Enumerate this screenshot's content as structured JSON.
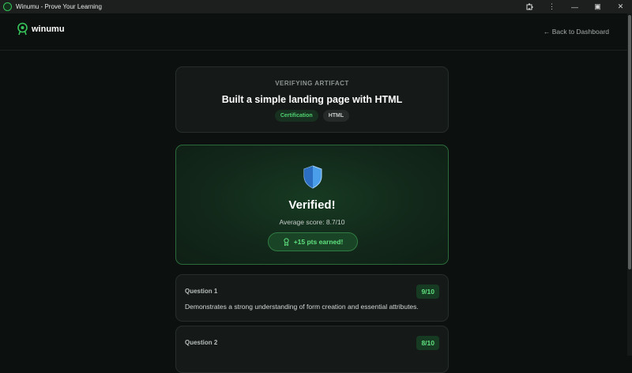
{
  "window": {
    "title": "Winumu - Prove Your Learning",
    "controls": {
      "extensions": "extensions-icon",
      "menu": "⋮",
      "minimize": "—",
      "restore": "▣",
      "close": "✕"
    }
  },
  "header": {
    "brand": "winumu",
    "back_link": "← Back to Dashboard"
  },
  "artifact": {
    "eyebrow": "VERIFYING ARTIFACT",
    "title": "Built a simple landing page with HTML",
    "tags": [
      "Certification",
      "HTML"
    ]
  },
  "verification": {
    "status": "Verified!",
    "average_score": "Average score: 8.7/10",
    "points": "+15 pts earned!"
  },
  "questions": [
    {
      "label": "Question 1",
      "score": "9/10",
      "feedback": "Demonstrates a strong understanding of form creation and essential attributes."
    },
    {
      "label": "Question 2",
      "score": "8/10",
      "feedback": ""
    }
  ],
  "colors": {
    "accent": "#4fd070",
    "background": "#0c1110",
    "card": "#151a19",
    "shield_blue": "#4a9eea"
  }
}
